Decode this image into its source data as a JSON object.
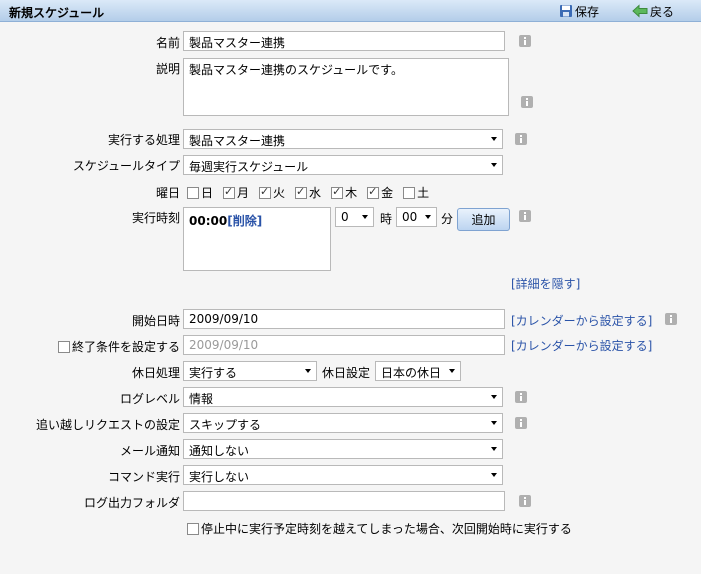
{
  "header": {
    "title": "新規スケジュール",
    "save_label": "保存",
    "back_label": "戻る"
  },
  "form": {
    "name": {
      "label": "名前",
      "value": "製品マスター連携"
    },
    "description": {
      "label": "説明",
      "value": "製品マスター連携のスケジュールです。"
    },
    "process": {
      "label": "実行する処理",
      "value": "製品マスター連携"
    },
    "schedule_type": {
      "label": "スケジュールタイプ",
      "value": "毎週実行スケジュール"
    },
    "weekdays": {
      "label": "曜日",
      "days": [
        {
          "name": "日",
          "checked": false
        },
        {
          "name": "月",
          "checked": true
        },
        {
          "name": "火",
          "checked": true
        },
        {
          "name": "水",
          "checked": true
        },
        {
          "name": "木",
          "checked": true
        },
        {
          "name": "金",
          "checked": true
        },
        {
          "name": "土",
          "checked": false
        }
      ]
    },
    "exec_time": {
      "label": "実行時刻",
      "entry_time": "00:00",
      "entry_delete": "[削除]",
      "hour_value": "0",
      "hour_unit": "時",
      "minute_value": "00",
      "minute_unit": "分",
      "add_label": "追加"
    },
    "hide_details": "[詳細を隠す]",
    "start_datetime": {
      "label": "開始日時",
      "value": "2009/09/10",
      "calendar_link": "[カレンダーから設定する]"
    },
    "end_condition": {
      "label": "終了条件を設定する",
      "checked": false,
      "value": "2009/09/10",
      "calendar_link": "[カレンダーから設定する]"
    },
    "holiday_handling": {
      "label": "休日処理",
      "value": "実行する",
      "setting_label": "休日設定",
      "setting_value": "日本の休日"
    },
    "log_level": {
      "label": "ログレベル",
      "value": "情報"
    },
    "overtaking": {
      "label": "追い越しリクエストの設定",
      "value": "スキップする"
    },
    "mail": {
      "label": "メール通知",
      "value": "通知しない"
    },
    "command": {
      "label": "コマンド実行",
      "value": "実行しない"
    },
    "log_folder": {
      "label": "ログ出力フォルダ",
      "value": ""
    },
    "resume_option": {
      "label": "停止中に実行予定時刻を越えてしまった場合、次回開始時に実行する",
      "checked": false
    }
  },
  "colors": {
    "link": "#2a53a8",
    "header_top": "#dbe9f8",
    "header_bottom": "#b3cde9"
  }
}
